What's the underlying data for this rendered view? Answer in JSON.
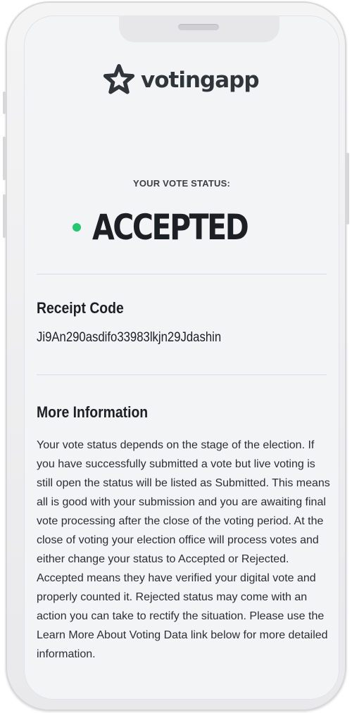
{
  "app": {
    "logo_text": "votingapp",
    "brand_color": "#2f353b"
  },
  "status": {
    "label": "YOUR VOTE STATUS:",
    "value": "ACCEPTED",
    "dot_color": "#28c76f"
  },
  "receipt": {
    "title": "Receipt Code",
    "code": "Ji9An290asdifo33983lkjn29Jdashin"
  },
  "info": {
    "title": "More Information",
    "body": "Your vote status depends on the stage of the election. If you have successfully submitted a vote but live voting is still open the status will be listed as Submitted. This means all is good with your submission and you are awaiting final vote processing after the close of the voting period. At the close of voting your election office will process votes and either change your status to Accepted or Rejected. Accepted means they have verified your digital vote and properly counted it. Rejected status may come with an action you can take to rectify the situation. Please use the Learn More About Voting Data link below for more detailed information."
  }
}
